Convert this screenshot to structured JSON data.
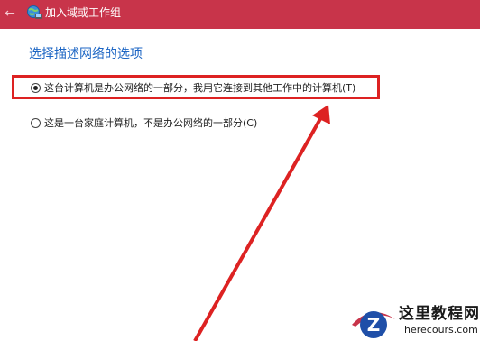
{
  "window": {
    "title": "加入域或工作组",
    "back_icon": "back-arrow-icon",
    "app_icon": "network-globe-icon",
    "titlebar_color": "#c8344a"
  },
  "main": {
    "heading": "选择描述网络的选项",
    "options": [
      {
        "label": "这台计算机是办公网络的一部分，我用它连接到其他工作中的计算机(T)",
        "selected": true
      },
      {
        "label": "这是一台家庭计算机，不是办公网络的一部分(C)",
        "selected": false
      }
    ]
  },
  "annotation": {
    "highlight_color": "#dd2222",
    "arrow_color": "#dd2222"
  },
  "watermark": {
    "title": "这里教程网",
    "url": "herecours.com"
  }
}
